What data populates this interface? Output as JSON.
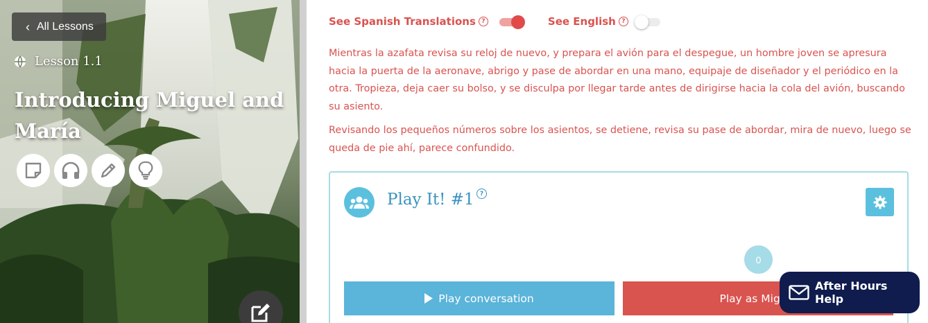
{
  "hero": {
    "back_label": "All Lessons",
    "lesson_number": "Lesson 1.1",
    "lesson_title": "Introducing Miguel and María",
    "tools": [
      {
        "icon": "sticky-note-icon"
      },
      {
        "icon": "headphones-icon"
      },
      {
        "icon": "pencil-icon"
      },
      {
        "icon": "lightbulb-icon"
      }
    ],
    "note_fab_icon": "edit-icon"
  },
  "toggles": {
    "spanish_label": "See Spanish Translations",
    "spanish_on": true,
    "english_label": "See English",
    "english_on": false,
    "help_glyph": "?"
  },
  "paragraphs": [
    "Mientras la azafata revisa su reloj de nuevo, y prepara el avión para el despegue, un hombre joven se apresura hacia la puerta de la aeronave, abrigo y pase de abordar en una mano, equipaje de diseñador y el periódico en la otra. Tropieza, deja caer su bolso, y se disculpa por llegar tarde antes de dirigirse hacia la cola del avión, buscando su asiento.",
    "Revisando los pequeños números sobre los asientos, se detiene, revisa su pase de abordar, mira de nuevo, luego se queda de pie ahí, parece confundido."
  ],
  "play_it": {
    "title": "Play It! #1",
    "help_glyph": "?",
    "counter": "0",
    "play_conversation_label": "Play conversation",
    "play_as_label": "Play as Miguel"
  },
  "after_hours": {
    "label": "After Hours Help"
  },
  "colors": {
    "accent_red": "#d9534f",
    "accent_blue": "#5bc0de",
    "title_blue": "#3a93bf",
    "help_navy": "#0f1c4d"
  }
}
